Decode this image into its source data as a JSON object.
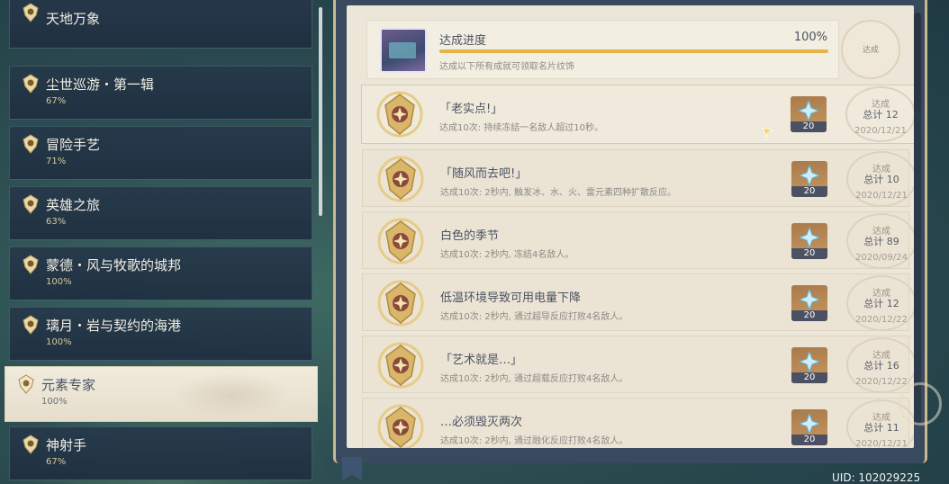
{
  "sidebar": {
    "categories": [
      {
        "name": "天地万象",
        "pct": ""
      },
      {
        "name": "尘世巡游・第一辑",
        "pct": "67%"
      },
      {
        "name": "冒险手艺",
        "pct": "71%"
      },
      {
        "name": "英雄之旅",
        "pct": "63%"
      },
      {
        "name": "蒙德・风与牧歌的城邦",
        "pct": "100%"
      },
      {
        "name": "璃月・岩与契约的海港",
        "pct": "100%"
      },
      {
        "name": "元素专家",
        "pct": "100%"
      },
      {
        "name": "神射手",
        "pct": "67%"
      }
    ],
    "active_index": 6
  },
  "progress": {
    "title": "达成进度",
    "percent": "100%",
    "fill_fraction": 1.0,
    "description": "达成以下所有成就可领取名片纹饰",
    "stamp": "达成"
  },
  "achievements": [
    {
      "title": "「老实点!」",
      "desc": "达成10次: 持续冻结一名敌人超过10秒。",
      "reward_qty": "20",
      "stamp_status": "达成",
      "stamp_total": "总计 12",
      "date": "2020/12/21"
    },
    {
      "title": "「随风而去吧!」",
      "desc": "达成10次: 2秒内, 触发冰、水、火、雷元素四种扩散反应。",
      "reward_qty": "20",
      "stamp_status": "达成",
      "stamp_total": "总计 10",
      "date": "2020/12/21"
    },
    {
      "title": "白色的季节",
      "desc": "达成10次: 2秒内, 冻结4名敌人。",
      "reward_qty": "20",
      "stamp_status": "达成",
      "stamp_total": "总计 89",
      "date": "2020/09/24"
    },
    {
      "title": "低温环境导致可用电量下降",
      "desc": "达成10次: 2秒内, 通过超导反应打败4名敌人。",
      "reward_qty": "20",
      "stamp_status": "达成",
      "stamp_total": "总计 12",
      "date": "2020/12/22"
    },
    {
      "title": "「艺术就是…」",
      "desc": "达成10次: 2秒内, 通过超载反应打败4名敌人。",
      "reward_qty": "20",
      "stamp_status": "达成",
      "stamp_total": "总计 16",
      "date": "2020/12/22"
    },
    {
      "title": "…必须毁灭两次",
      "desc": "达成10次: 2秒内, 通过融化反应打败4名敌人。",
      "reward_qty": "20",
      "stamp_status": "达成",
      "stamp_total": "总计 11",
      "date": "2020/12/21"
    }
  ],
  "uid": "UID: 102029225",
  "colors": {
    "accent_gold": "#e6b446",
    "panel_frame": "#c9b98e",
    "reward_bg": "#b4865a"
  }
}
